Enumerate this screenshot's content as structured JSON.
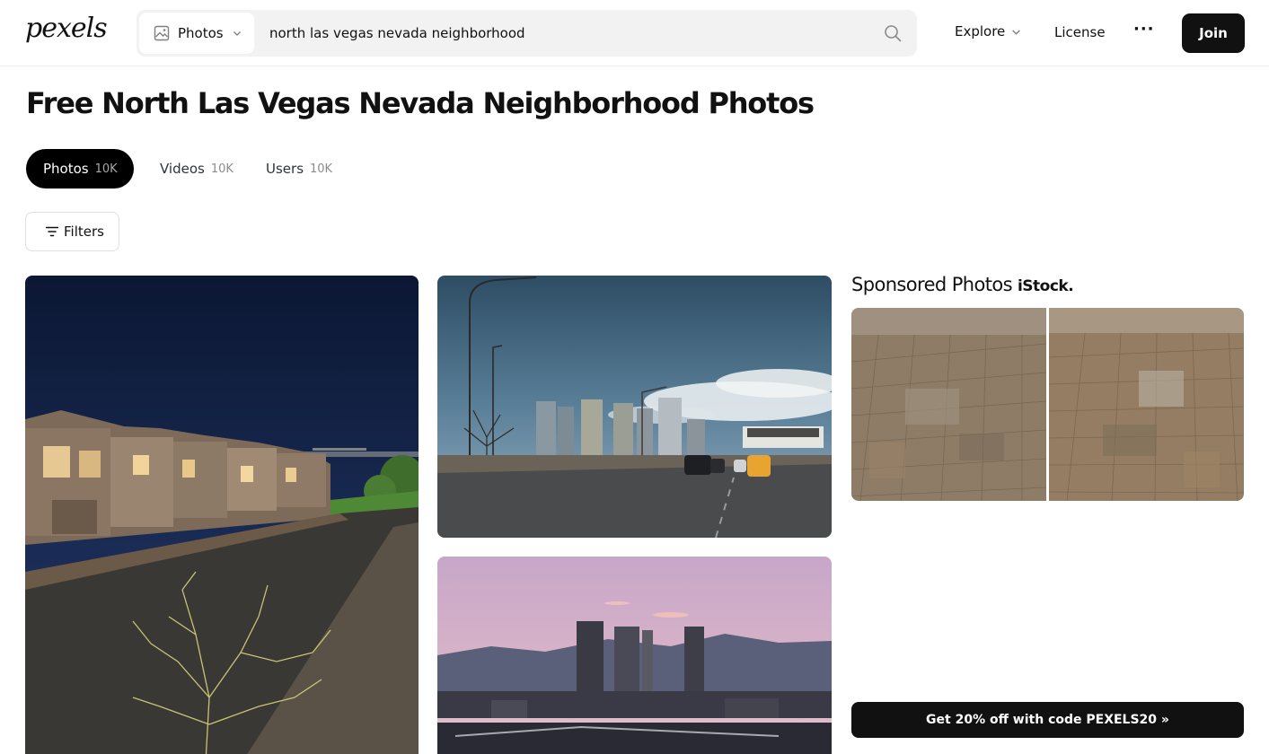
{
  "header": {
    "logo": "pexels",
    "search": {
      "type_label": "Photos",
      "value": "north las vegas nevada neighborhood"
    },
    "nav": {
      "explore": "Explore",
      "license": "License",
      "more": "···",
      "join": "Join"
    }
  },
  "page": {
    "title": "Free North Las Vegas Nevada Neighborhood Photos"
  },
  "tabs": [
    {
      "label": "Photos",
      "count": "10K",
      "active": true
    },
    {
      "label": "Videos",
      "count": "10K",
      "active": false
    },
    {
      "label": "Users",
      "count": "10K",
      "active": false
    }
  ],
  "filters": {
    "label": "Filters"
  },
  "sponsored": {
    "title": "Sponsored Photos",
    "brand": "iStock.",
    "promo": "Get 20% off with code PEXELS20 »"
  },
  "colors": {
    "accent": "#111111",
    "search_bg": "#f2f2f3"
  },
  "icons": {
    "search_type": "image-icon",
    "search": "search-icon",
    "filters": "filter-lines-icon",
    "dropdown": "chevron-down-icon"
  }
}
